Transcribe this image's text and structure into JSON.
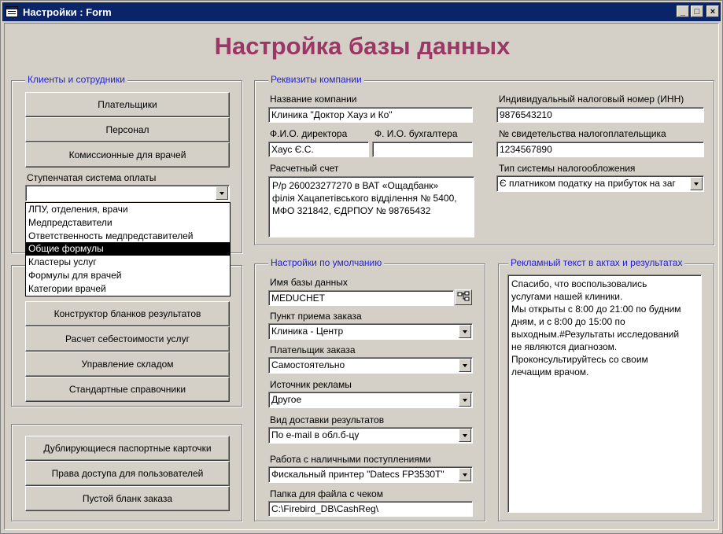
{
  "window": {
    "title": "Настройки : Form",
    "minimize": "_",
    "maximize": "□",
    "close": "×"
  },
  "heading": "Настройка базы данных",
  "clients": {
    "legend": "Клиенты и сотрудники",
    "buttons": [
      "Плательщики",
      "Персонал",
      "Комиссионные для врачей"
    ],
    "tier_label": "Ступенчатая система оплаты",
    "tier_value": "",
    "dropdown_items": [
      "ЛПУ, отделения, врачи",
      "Медпредставители",
      "Ответственность медпредставителей",
      "Общие формулы",
      "Кластеры услуг",
      "Формулы для врачей",
      "Категории врачей"
    ],
    "dropdown_selected_index": 3
  },
  "tools": {
    "buttons": [
      "Конструктор бланков результатов",
      "Расчет себестоимости услуг",
      "Управление складом",
      "Стандартные справочники"
    ]
  },
  "misc": {
    "buttons": [
      "Дублирующиеся паспортные карточки",
      "Права доступа для пользователей",
      "Пустой бланк заказа"
    ]
  },
  "company": {
    "legend": "Реквизиты компании",
    "name_label": "Название компании",
    "name_value": "Клиника \"Доктор Хауз и Ко\"",
    "director_label": "Ф.И.О. директора",
    "director_value": "Хаус Є.С.",
    "accountant_label": "Ф. И.О. бухгалтера",
    "accountant_value": "",
    "account_label": "Расчетный счет",
    "account_value": "Р/р 260023277270 в ВАТ «Ощадбанк»\nфілія Хацапетівського відділення № 5400,\nМФО 321842, ЄДРПОУ № 98765432",
    "inn_label": "Индивидуальный налоговый номер (ИНН)",
    "inn_value": "9876543210",
    "cert_label": "№ свидетельства налогоплательщика",
    "cert_value": "1234567890",
    "tax_label": "Тип системы налогообложения",
    "tax_value": "Є платником податку на прибуток на заг"
  },
  "defaults": {
    "legend": "Настройки по умолчанию",
    "db_label": "Имя базы данных",
    "db_value": "MEDUCHET",
    "point_label": "Пункт приема заказа",
    "point_value": "Клиника - Центр",
    "payer_label": "Плательщик заказа",
    "payer_value": "Самостоятельно",
    "ad_label": "Источник рекламы",
    "ad_value": "Другое",
    "delivery_label": "Вид доставки результатов",
    "delivery_value": "По e-mail в обл.б-цу",
    "cash_label": "Работа с наличными поступлениями",
    "cash_value": "Фискальный принтер \"Datecs FP3530T\"",
    "folder_label": "Папка для файла с чеком",
    "folder_value": "C:\\Firebird_DB\\CashReg\\"
  },
  "promo": {
    "legend": "Рекламный текст в актах и результатах",
    "text": "Спасибо, что воспользовались\nуслугами нашей клиники.\nМы открыты с 8:00 до 21:00 по будним\nдням, и с 8:00 до 15:00 по\nвыходным.#Результаты исследований\nне являются диагнозом.\nПроконсультируйтесь со своим\nлечащим врачом."
  },
  "colors": {
    "title_bar": "#0a246a",
    "heading": "#9b3765",
    "legend": "#1f1fd6",
    "face": "#d4d0c8"
  }
}
